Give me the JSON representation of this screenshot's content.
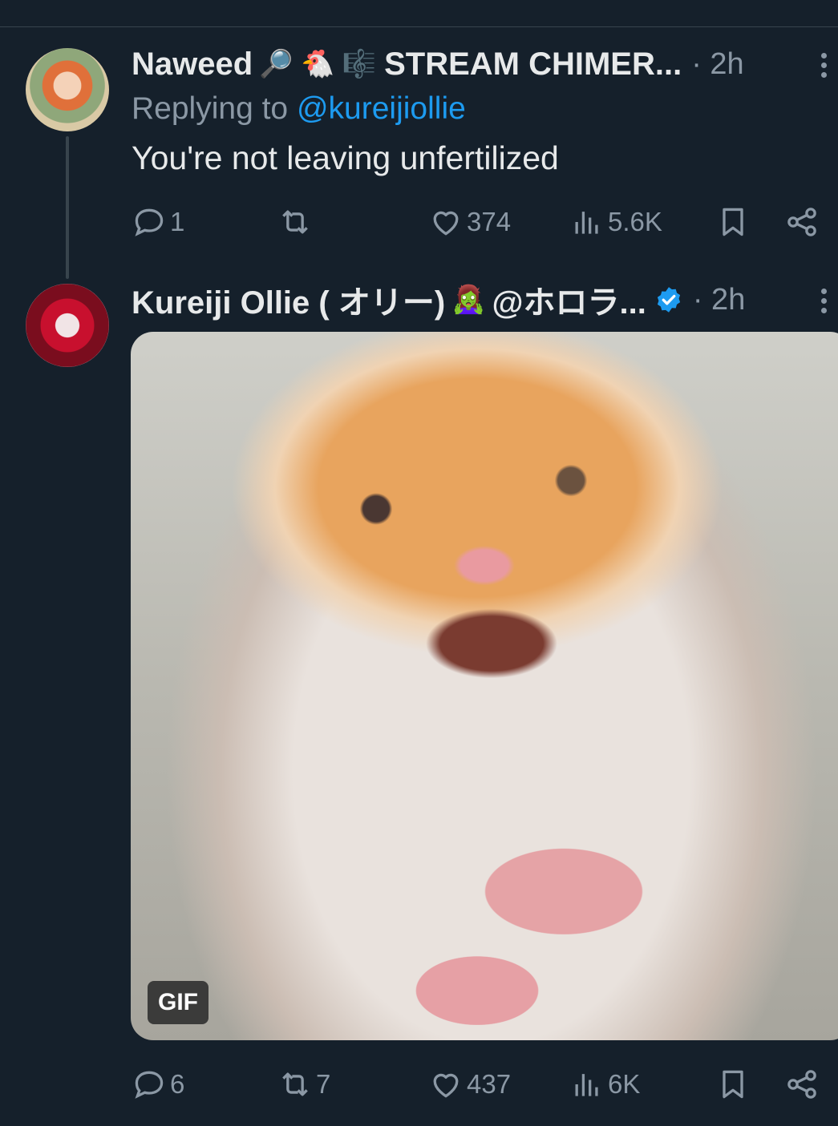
{
  "tweet1": {
    "name": "Naweed",
    "emojis": "🔎 🐔 🎼",
    "name_suffix": "STREAM CHIMER...",
    "time": "· 2h",
    "reply_prefix": "Replying to",
    "reply_handle": "@kureijiollie",
    "text": "You're not leaving unfertilized",
    "replies": "1",
    "retweets": "",
    "likes": "374",
    "views": "5.6K"
  },
  "tweet2": {
    "name": "Kureiji Ollie ( オリー)",
    "emoji": "🧟‍♀️",
    "handle": "@ホロラ...",
    "time": "· 2h",
    "media_badge": "GIF",
    "replies": "6",
    "retweets": "7",
    "likes": "437",
    "views": "6K"
  },
  "colors": {
    "background": "#15202b",
    "text": "#e7e9ea",
    "muted": "#8b98a5",
    "accent": "#1d9bf0"
  },
  "icons": [
    "reply-icon",
    "retweet-icon",
    "like-icon",
    "views-icon",
    "bookmark-icon",
    "share-icon",
    "more-icon",
    "verified-icon"
  ]
}
